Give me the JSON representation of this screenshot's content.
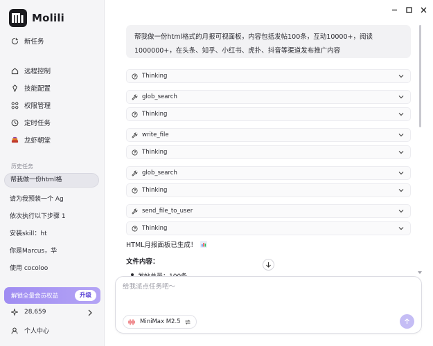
{
  "app": {
    "name": "Molili"
  },
  "sidebar": {
    "new_task": "新任务",
    "nav": [
      {
        "label": "远程控制",
        "icon": "remote-icon"
      },
      {
        "label": "技能配置",
        "icon": "skill-icon"
      },
      {
        "label": "权限管理",
        "icon": "permission-icon"
      },
      {
        "label": "定时任务",
        "icon": "clock-icon"
      },
      {
        "label": "龙虾朝堂",
        "icon": "lobster-icon"
      }
    ],
    "history_label": "历史任务",
    "history": [
      "帮我做一份html格",
      "请为我预装一个 Ag",
      "依次执行以下步骤 1",
      "安装skill：ht",
      "你是Marcus，华",
      "使用 cocoloo"
    ],
    "upgrade_text": "解锁全量会员权益",
    "upgrade_button": "升级",
    "credits": "28,659",
    "profile": "个人中心"
  },
  "chat": {
    "user_message": "帮我做一份html格式的月报可视面板，内容包括发帖100条，互动10000+，阅读1000000+，在头条、知乎、小红书、虎扑、抖音等渠道发布推广内容",
    "steps": [
      {
        "label": "Thinking",
        "icon": "thinking-icon"
      },
      {
        "label": "glob_search",
        "icon": "tool-icon"
      },
      {
        "label": "Thinking",
        "icon": "thinking-icon"
      },
      {
        "label": "write_file",
        "icon": "tool-icon"
      },
      {
        "label": "Thinking",
        "icon": "thinking-icon"
      },
      {
        "label": "glob_search",
        "icon": "tool-icon"
      },
      {
        "label": "Thinking",
        "icon": "thinking-icon"
      },
      {
        "label": "send_file_to_user",
        "icon": "tool-icon"
      },
      {
        "label": "Thinking",
        "icon": "thinking-icon"
      }
    ],
    "result_text": "HTML月报面板已生成！",
    "file_heading": "文件内容：",
    "bullet_preview": "发帖总量：100条"
  },
  "composer": {
    "placeholder": "给我派点任务吧～",
    "model": "MiniMax M2.5"
  },
  "colors": {
    "accent": "#9f8cf2",
    "send": "#c5bdf5"
  }
}
